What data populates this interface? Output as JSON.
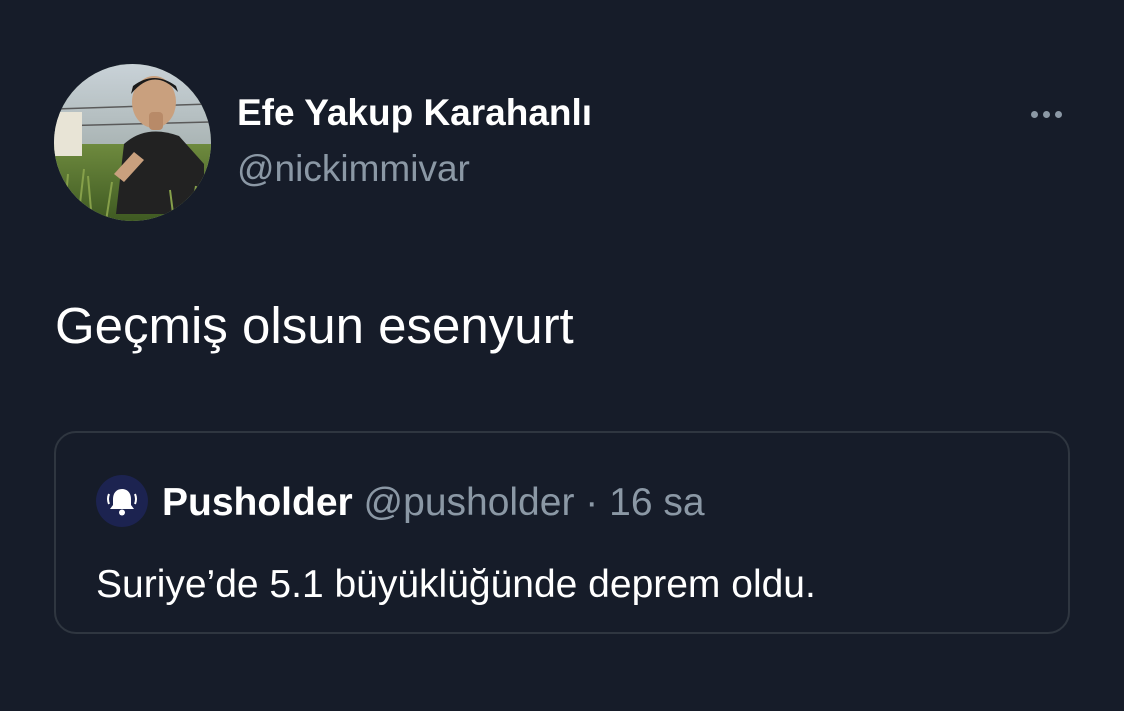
{
  "tweet": {
    "author": {
      "name": "Efe Yakup Karahanlı",
      "handle": "@nickimmivar"
    },
    "text": "Geçmiş olsun esenyurt",
    "more_icon": "more-horizontal-icon"
  },
  "quoted_tweet": {
    "author": {
      "name": "Pusholder",
      "handle": "@pusholder",
      "avatar_icon": "bell-icon"
    },
    "separator": "·",
    "time": "16 sa",
    "text": "Suriye’de 5.1 büyüklüğünde deprem oldu."
  },
  "colors": {
    "background": "#161c29",
    "text_primary": "#ffffff",
    "text_secondary": "#8b98a5",
    "card_border": "#2f3640",
    "quote_avatar_bg": "#1c2350"
  }
}
